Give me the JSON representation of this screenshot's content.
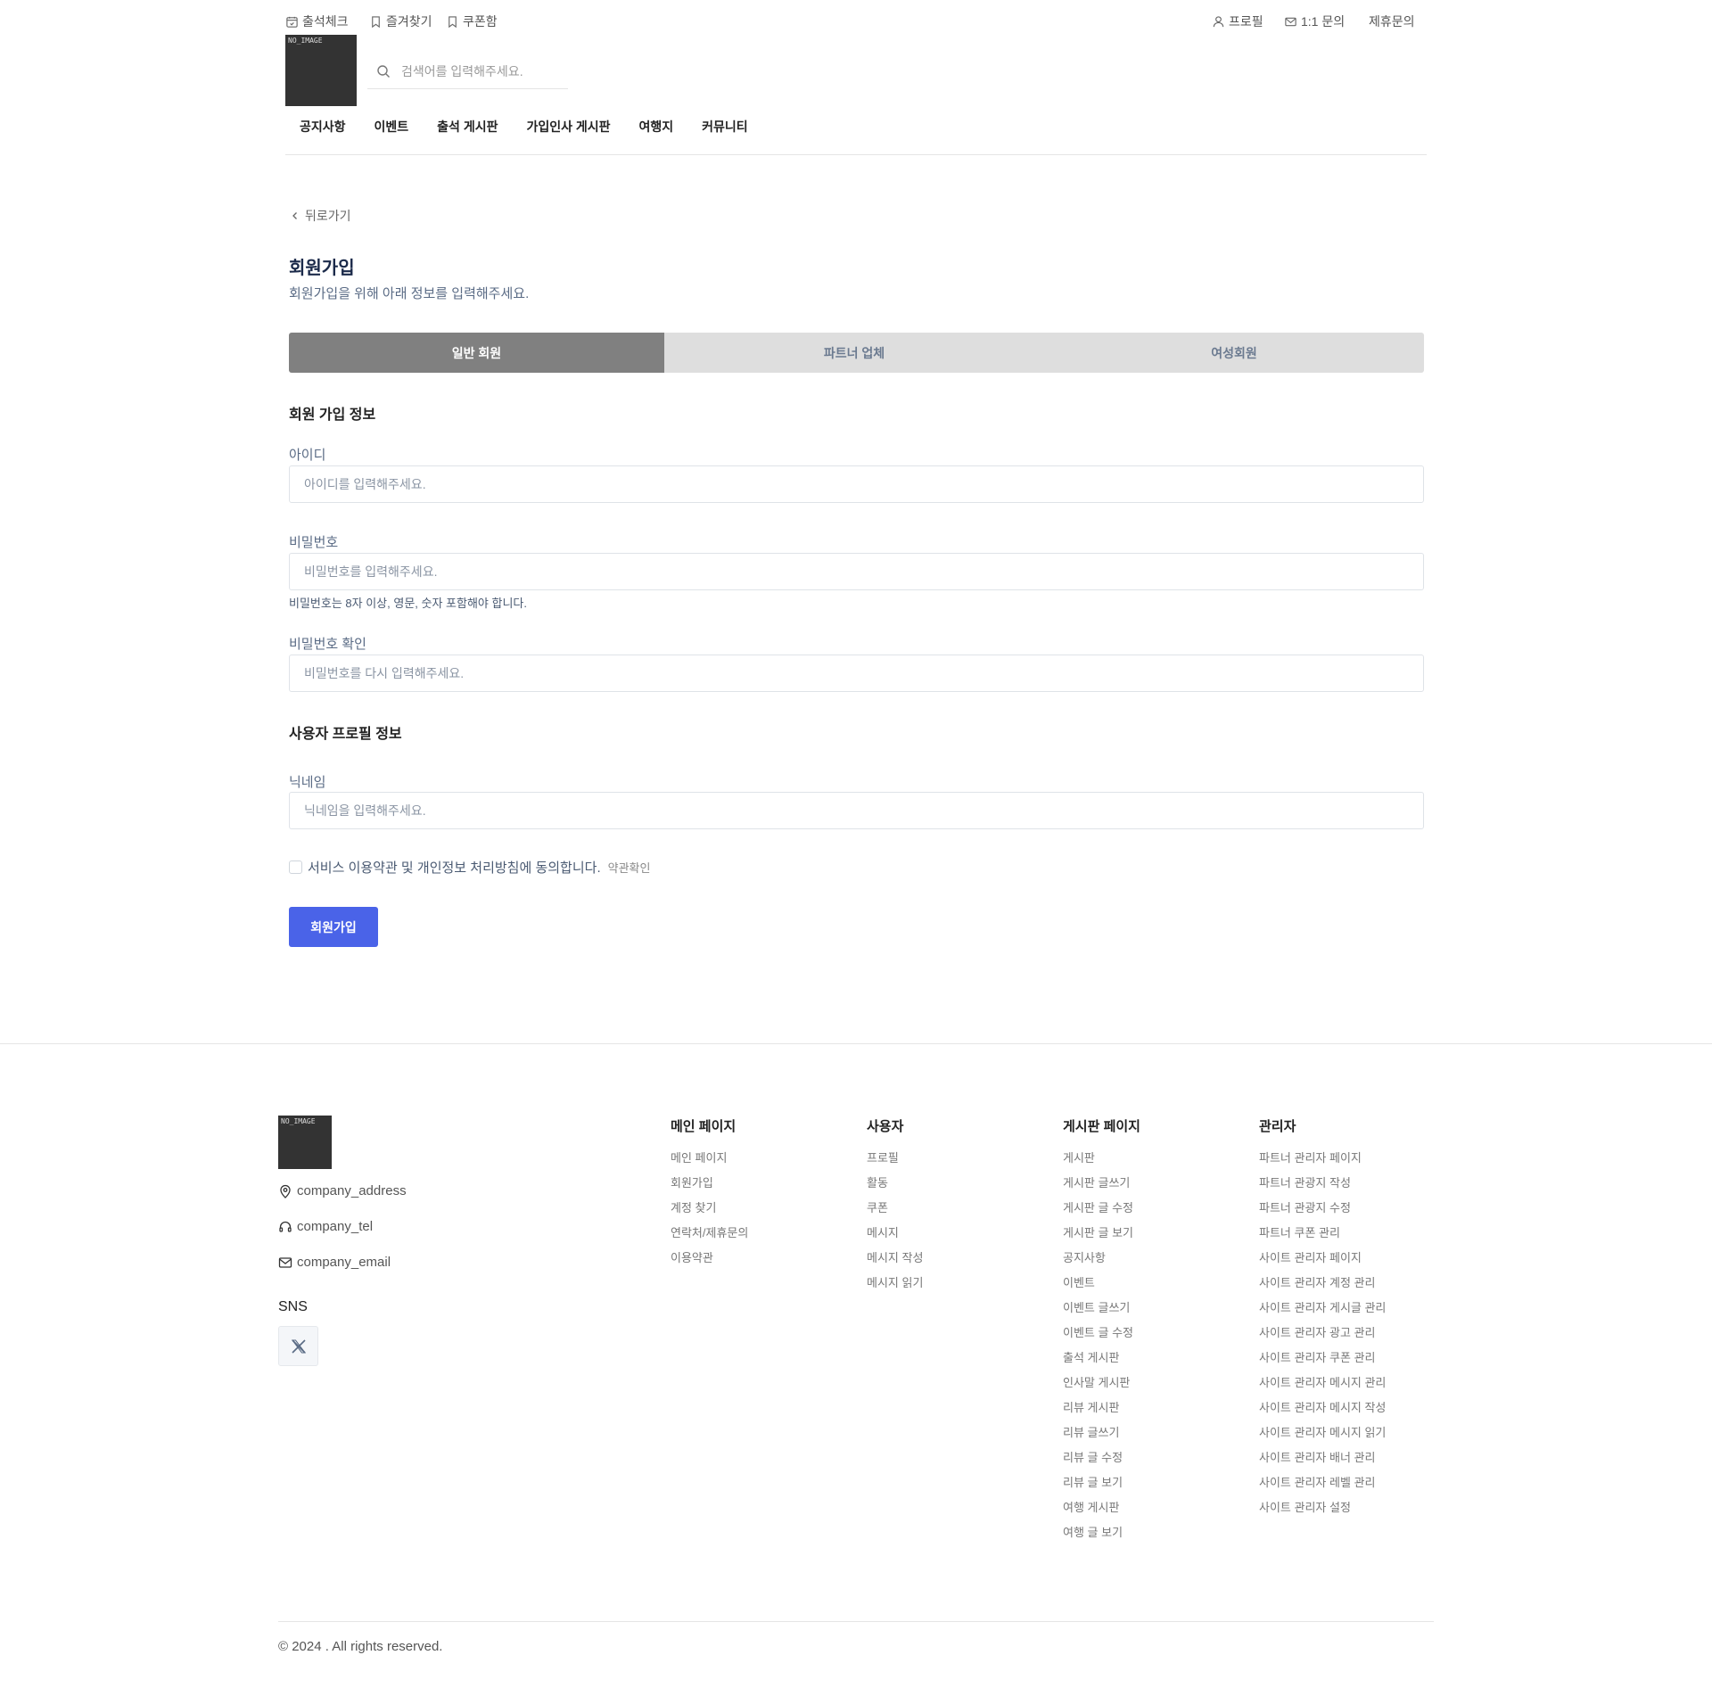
{
  "header": {
    "util_left": [
      {
        "label": "출석체크",
        "icon": "calendar-check-icon"
      },
      {
        "label": "즐겨찾기",
        "icon": "bookmark-icon"
      },
      {
        "label": "쿠폰함",
        "icon": "coupon-icon"
      }
    ],
    "util_right": [
      {
        "label": "프로필",
        "icon": "user-icon"
      },
      {
        "label": "1:1 문의",
        "icon": "mail-icon"
      },
      {
        "label": "제휴문의"
      }
    ],
    "logo_text": "NO_IMAGE",
    "search_placeholder": "검색어를 입력해주세요.",
    "nav": [
      "공지사항",
      "이벤트",
      "출석 게시판",
      "가입인사 게시판",
      "여행지",
      "커뮤니티"
    ]
  },
  "main": {
    "back_label": "뒤로가기",
    "title": "회원가입",
    "subtitle": "회원가입을 위해 아래 정보를 입력해주세요.",
    "tabs": [
      "일반 회원",
      "파트너 업체",
      "여성회원"
    ],
    "active_tab": "일반 회원",
    "section_account": "회원 가입 정보",
    "id_label": "아이디",
    "id_placeholder": "아이디를 입력해주세요.",
    "pw_label": "비밀번호",
    "pw_placeholder": "비밀번호를 입력해주세요.",
    "pw_hint": "비밀번호는 8자 이상, 영문, 숫자 포함해야 합니다.",
    "pw2_label": "비밀번호 확인",
    "pw2_placeholder": "비밀번호를 다시 입력해주세요.",
    "section_profile": "사용자 프로필 정보",
    "nick_label": "닉네임",
    "nick_placeholder": "닉네임을 입력해주세요.",
    "agree_text": "서비스 이용약관 및 개인정보 처리방침에 동의합니다.",
    "terms_link": "약관확인",
    "submit_label": "회원가입",
    "accent_color": "#4a63e8"
  },
  "footer": {
    "logo_text": "NO_IMAGE",
    "address": "company_address",
    "tel": "company_tel",
    "email": "company_email",
    "sns_title": "SNS",
    "columns": [
      {
        "title": "메인 페이지",
        "items": [
          "메인 페이지",
          "회원가입",
          "계정 찾기",
          "연락처/제휴문의",
          "이용약관"
        ]
      },
      {
        "title": "사용자",
        "items": [
          "프로필",
          "활동",
          "쿠폰",
          "메시지",
          "메시지 작성",
          "메시지 읽기"
        ]
      },
      {
        "title": "게시판 페이지",
        "items": [
          "게시판",
          "게시판 글쓰기",
          "게시판 글 수정",
          "게시판 글 보기",
          "공지사항",
          "이벤트",
          "이벤트 글쓰기",
          "이벤트 글 수정",
          "출석 게시판",
          "인사말 게시판",
          "리뷰 게시판",
          "리뷰 글쓰기",
          "리뷰 글 수정",
          "리뷰 글 보기",
          "여행 게시판",
          "여행 글 보기"
        ]
      },
      {
        "title": "관리자",
        "items": [
          "파트너 관리자 페이지",
          "파트너 관광지 작성",
          "파트너 관광지 수정",
          "파트너 쿠폰 관리",
          "사이트 관리자 페이지",
          "사이트 관리자 계정 관리",
          "사이트 관리자 게시글 관리",
          "사이트 관리자 광고 관리",
          "사이트 관리자 쿠폰 관리",
          "사이트 관리자 메시지 관리",
          "사이트 관리자 메시지 작성",
          "사이트 관리자 메시지 읽기",
          "사이트 관리자 배너 관리",
          "사이트 관리자 레벨 관리",
          "사이트 관리자 설정"
        ]
      }
    ],
    "copyright": "© 2024 . All rights reserved."
  }
}
